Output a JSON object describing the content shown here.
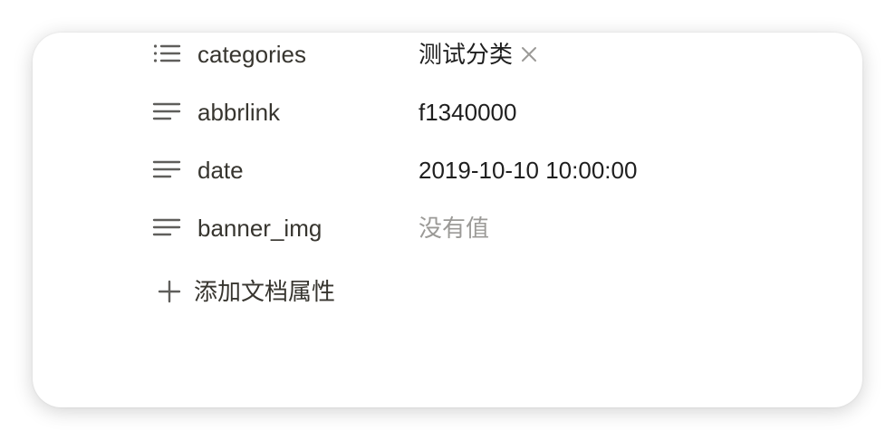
{
  "properties": [
    {
      "name": "categories",
      "icon": "multi-select-list-icon",
      "tags": [
        "测试分类"
      ]
    },
    {
      "name": "abbrlink",
      "icon": "text-lines-icon",
      "value": "f1340000"
    },
    {
      "name": "date",
      "icon": "text-lines-icon",
      "value": "2019-10-10 10:00:00"
    },
    {
      "name": "banner_img",
      "icon": "text-lines-icon",
      "value": "没有值",
      "empty": true
    }
  ],
  "add_property": {
    "icon": "plus-icon",
    "label": "添加文档属性"
  },
  "colors": {
    "text": "#37352f",
    "value": "#1f1f1f",
    "placeholder": "#9b9a97",
    "icon": "#5f5e5b",
    "tag_remove": "#9b9a97"
  }
}
